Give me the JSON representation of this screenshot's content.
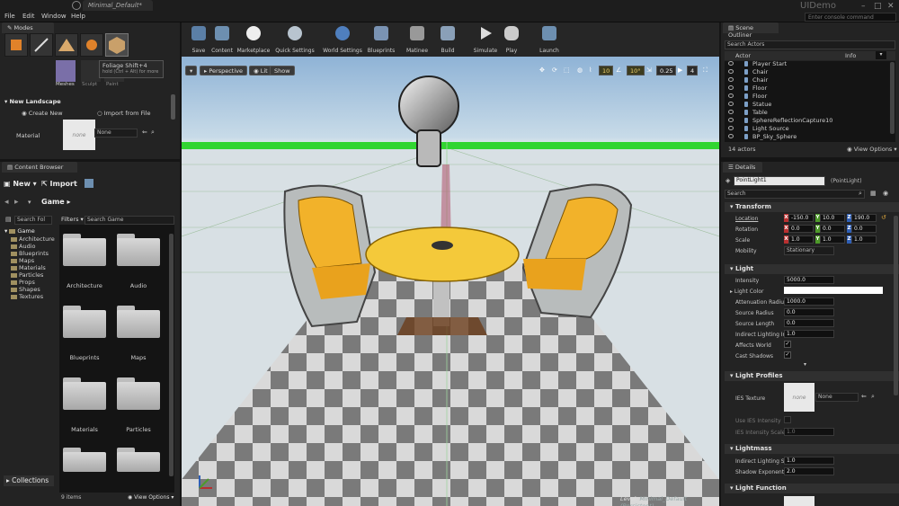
{
  "window": {
    "tab_title": "Minimal_Default*",
    "app_title": "UIDemo",
    "console_placeholder": "Enter console command",
    "menu": [
      "File",
      "Edit",
      "Window",
      "Help"
    ]
  },
  "modes": {
    "tab_label": "Modes",
    "sub_labels": [
      "Meshes",
      "Sculpt",
      "Paint"
    ],
    "tooltip_title": "Foliage Shift+4",
    "tooltip_hint": "hold (Ctrl + Alt) for more",
    "section_title": "New Landscape",
    "create_new": "Create New",
    "import_from_file": "Import from File",
    "material_label": "Material",
    "material_thumb_text": "none",
    "material_value": "None"
  },
  "content_browser": {
    "tab_label": "Content Browser",
    "new_button": "New",
    "import_button": "Import",
    "breadcrumb": "Game",
    "search_folders_placeholder": "Search Fol",
    "filters_label": "Filters",
    "search_game_placeholder": "Search Game",
    "tree_root": "Game",
    "tree_items": [
      "Architecture",
      "Audio",
      "Blueprints",
      "Maps",
      "Materials",
      "Particles",
      "Props",
      "Shapes",
      "Textures"
    ],
    "folders": [
      "Architecture",
      "Audio",
      "Blueprints",
      "Maps",
      "Materials",
      "Particles"
    ],
    "collections_label": "Collections",
    "item_count": "9 items",
    "view_options": "View Options"
  },
  "toolbar": {
    "items": [
      "Save",
      "Content",
      "Marketplace",
      "Quick Settings",
      "World Settings",
      "Blueprints",
      "Matinee",
      "Build",
      "Simulate",
      "Play",
      "Launch"
    ]
  },
  "viewport": {
    "perspective": "Perspective",
    "lit": "Lit",
    "show": "Show",
    "grid_snap": "10",
    "rot_snap": "10°",
    "scale_snap": "0.25",
    "cam_speed": "4",
    "level_prefix": "Level:",
    "level_name": "Minimal_Default (Persistent)"
  },
  "outliner": {
    "tab_label": "Scene Outliner",
    "search_placeholder": "Search Actors",
    "col_actor": "Actor",
    "col_info": "Info",
    "rows": [
      "Player Start",
      "Chair",
      "Chair",
      "Floor",
      "Floor",
      "Statue",
      "Table",
      "SphereReflectionCapture10",
      "Light Source",
      "BP_Sky_Sphere"
    ],
    "actor_count": "14 actors",
    "view_options": "View Options"
  },
  "details": {
    "tab_label": "Details",
    "actor_name": "PointLight1",
    "actor_class": "(PointLight)",
    "search_placeholder": "Search",
    "transform": {
      "title": "Transform",
      "location_label": "Location",
      "location": [
        "-150.0",
        "10.0",
        "190.0"
      ],
      "rotation_label": "Rotation",
      "rotation": [
        "0.0",
        "0.0",
        "0.0"
      ],
      "scale_label": "Scale",
      "scale": [
        "1.0",
        "1.0",
        "1.0"
      ],
      "mobility_label": "Mobility",
      "mobility_value": "Stationary"
    },
    "light": {
      "title": "Light",
      "intensity_label": "Intensity",
      "intensity": "5000.0",
      "light_color_label": "Light Color",
      "attenuation_label": "Attenuation Radius",
      "attenuation": "1000.0",
      "source_radius_label": "Source Radius",
      "source_radius": "0.0",
      "source_length_label": "Source Length",
      "source_length": "0.0",
      "indirect_label": "Indirect Lighting In",
      "indirect": "1.0",
      "affects_world_label": "Affects World",
      "cast_shadows_label": "Cast Shadows"
    },
    "light_profiles": {
      "title": "Light Profiles",
      "ies_texture_label": "IES Texture",
      "ies_thumb_text": "none",
      "ies_value": "None",
      "use_ies_label": "Use IES Intensity",
      "ies_scale_label": "IES Intensity Scale",
      "ies_scale": "1.0"
    },
    "lightmass": {
      "title": "Lightmass",
      "indirect_scale_label": "Indirect Lighting Sc",
      "indirect_scale": "1.0",
      "shadow_exponent_label": "Shadow Exponent",
      "shadow_exponent": "2.0"
    },
    "light_function": {
      "title": "Light Function"
    }
  },
  "colors": {
    "accent_blue": "#6d8fb0",
    "grid_green": "#31d531",
    "chair_orange": "#f2b22a",
    "table_yellow": "#f4c93a",
    "axis_x": "#b83030",
    "axis_y": "#4e9a2a",
    "axis_z": "#2f5fb6"
  }
}
